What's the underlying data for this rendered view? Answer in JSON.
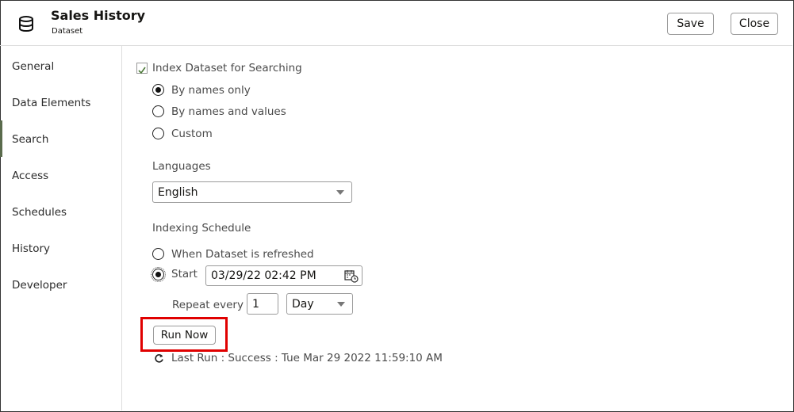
{
  "header": {
    "title": "Sales History",
    "subtitle": "Dataset",
    "icon": "database-icon",
    "save_label": "Save",
    "close_label": "Close"
  },
  "sidebar": {
    "items": [
      {
        "label": "General"
      },
      {
        "label": "Data Elements"
      },
      {
        "label": "Search",
        "active": true
      },
      {
        "label": "Access"
      },
      {
        "label": "Schedules"
      },
      {
        "label": "History"
      },
      {
        "label": "Developer"
      }
    ]
  },
  "search": {
    "index_label": "Index Dataset for Searching",
    "index_checked": true,
    "options": [
      "By names only",
      "By names and values",
      "Custom"
    ],
    "selected_option": "By names only",
    "languages_label": "Languages",
    "language_value": "English",
    "schedule_label": "Indexing Schedule",
    "when_refreshed_label": "When Dataset is refreshed",
    "start_label": "Start",
    "start_value": "03/29/22 02:42 PM",
    "repeat_label": "Repeat every",
    "repeat_value": "1",
    "repeat_unit": "Day",
    "run_now_label": "Run Now",
    "last_run": "Last Run : Success : Tue Mar 29 2022 11:59:10 AM",
    "highlight_color": "#e00000"
  }
}
